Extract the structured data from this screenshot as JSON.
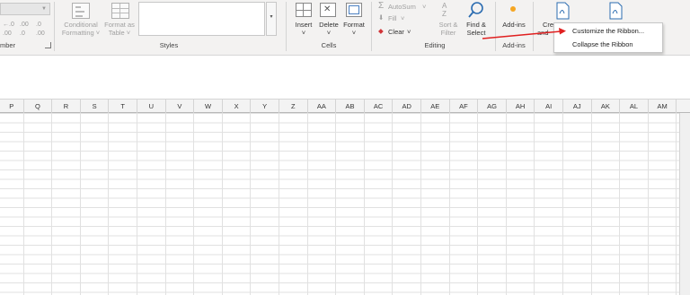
{
  "ribbon": {
    "number_group_label": "mber",
    "styles": {
      "conditional_formatting": [
        "Conditional",
        "Formatting ˅"
      ],
      "format_as_table": [
        "Format as",
        "Table ˅"
      ],
      "group_label": "Styles"
    },
    "cells": {
      "insert": "Insert",
      "delete": "Delete",
      "format": "Format",
      "group_label": "Cells"
    },
    "editing": {
      "autosum": "AutoSum",
      "fill": "Fill",
      "clear": "Clear",
      "sort_filter": [
        "Sort &",
        "Filter"
      ],
      "find_select": [
        "Find &",
        "Select"
      ],
      "group_label": "Editing"
    },
    "addins": {
      "button": "Add-ins",
      "group_label": "Add-ins"
    },
    "create": {
      "partial": [
        "Cre",
        "and"
      ]
    }
  },
  "context_menu": {
    "items": [
      "Customize the Ribbon...",
      "Collapse the Ribbon"
    ]
  },
  "grid": {
    "columns": [
      "P",
      "Q",
      "R",
      "S",
      "T",
      "U",
      "V",
      "W",
      "X",
      "Y",
      "Z",
      "AA",
      "AB",
      "AC",
      "AD",
      "AE",
      "AF",
      "AG",
      "AH",
      "AI",
      "AJ",
      "AK",
      "AL",
      "AM"
    ]
  },
  "colors": {
    "ribbon_bg": "#f3f2f1",
    "annotation_arrow": "#e02020",
    "addin_dot": "#f5a623",
    "find_icon": "#2b6cb0",
    "clear_icon": "#d13438"
  }
}
